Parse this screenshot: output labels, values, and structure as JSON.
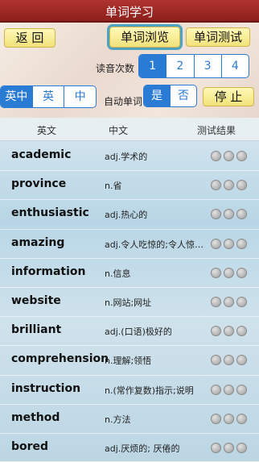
{
  "titlebar": {
    "title": "单词学习"
  },
  "controls": {
    "back_label": "返 回",
    "browse_label": "单词浏览",
    "test_label": "单词测试",
    "read_count_label": "读音次数",
    "read_count_options": [
      "1",
      "2",
      "3",
      "4"
    ],
    "read_count_selected": "1",
    "lang_options": [
      "英中",
      "英",
      "中"
    ],
    "lang_selected": "英中",
    "auto_label": "自动单词",
    "auto_options": [
      "是",
      "否"
    ],
    "auto_selected": "是",
    "stop_label": "停 止"
  },
  "table": {
    "headers": [
      "英文",
      "中文",
      "测试结果"
    ],
    "rows": [
      {
        "en": "academic",
        "cn": "adj.学术的"
      },
      {
        "en": "province",
        "cn": "n.省"
      },
      {
        "en": "enthusiastic",
        "cn": "adj.热心的"
      },
      {
        "en": "amazing",
        "cn": "adj.令人吃惊的;令人惊…"
      },
      {
        "en": "information",
        "cn": "n.信息"
      },
      {
        "en": "website",
        "cn": "n.网站;网址"
      },
      {
        "en": "brilliant",
        "cn": "adj.(口语)极好的"
      },
      {
        "en": "comprehension",
        "cn": "n.理解;领悟"
      },
      {
        "en": "instruction",
        "cn": "n.(常作复数)指示;说明"
      },
      {
        "en": "method",
        "cn": "n.方法"
      },
      {
        "en": "bored",
        "cn": "adj.厌烦的; 厌倦的"
      }
    ]
  }
}
